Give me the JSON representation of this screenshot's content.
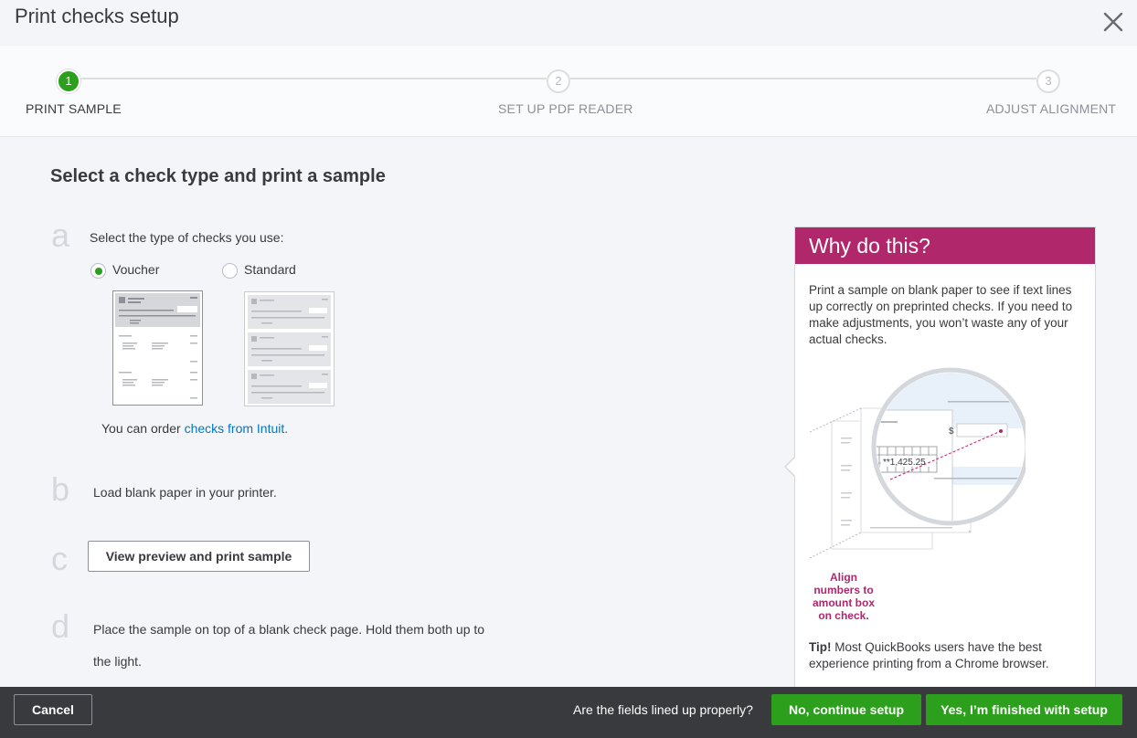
{
  "dialog": {
    "title": "Print checks setup",
    "close_icon": "close-icon"
  },
  "stepper": {
    "steps": [
      {
        "number": "1",
        "label": "PRINT SAMPLE",
        "state": "active"
      },
      {
        "number": "2",
        "label": "SET UP PDF READER",
        "state": "inactive"
      },
      {
        "number": "3",
        "label": "ADJUST ALIGNMENT",
        "state": "inactive"
      }
    ]
  },
  "main": {
    "heading": "Select a check type and print a sample",
    "step_a": {
      "letter": "a",
      "text": "Select the type of checks you use:",
      "options": [
        {
          "label": "Voucher",
          "checked": true
        },
        {
          "label": "Standard",
          "checked": false
        }
      ],
      "order_text": "You can order ",
      "order_link": "checks from Intuit."
    },
    "step_b": {
      "letter": "b",
      "text": "Load blank paper in your printer."
    },
    "step_c": {
      "letter": "c",
      "button": "View preview and print sample"
    },
    "step_d": {
      "letter": "d",
      "text_line1": "Place the sample on top of a blank check page. Hold them both up to",
      "text_line2": "the light."
    }
  },
  "why_panel": {
    "title": "Why do this?",
    "body": "Print a sample on blank paper to see if text lines up correctly on preprinted checks. If you need to make adjustments, you won’t waste any of your actual checks.",
    "illustration": {
      "dollar": "$",
      "amount": "**1,425.25"
    },
    "caption": "Align numbers to amount box on check.",
    "tip_label": "Tip!",
    "tip_text": " Most QuickBooks users have the best experience printing from a Chrome browser."
  },
  "footer": {
    "cancel": "Cancel",
    "question": "Are the fields lined up properly?",
    "no_button": "No, continue setup",
    "yes_button": "Yes, I’m finished with setup"
  },
  "colors": {
    "brand_green": "#2ca01c",
    "accent_magenta": "#b0286b",
    "link_blue": "#0077c5",
    "footer_dark": "#393a3d"
  }
}
